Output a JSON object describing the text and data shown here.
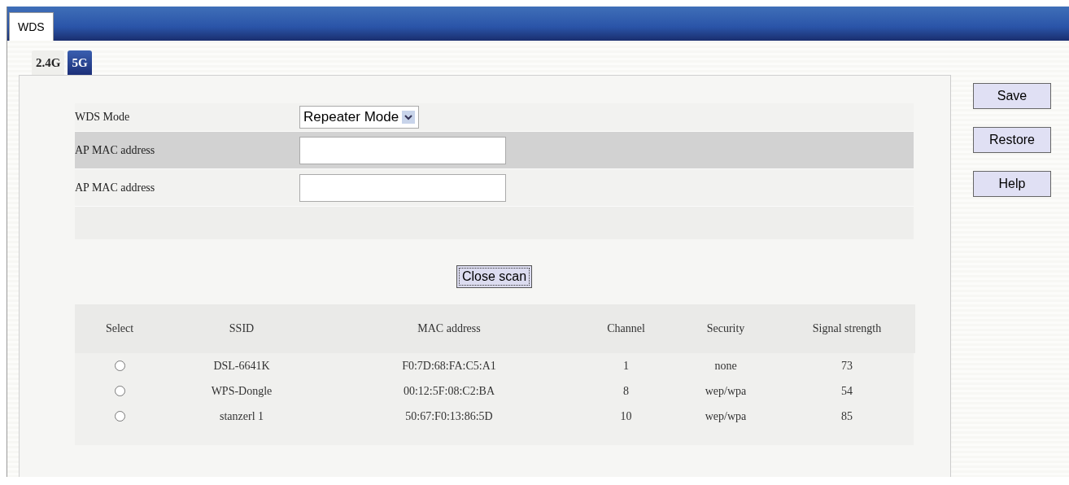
{
  "top_tab": {
    "label": "WDS",
    "selected": true
  },
  "band_tabs": [
    {
      "label": "2.4G",
      "selected": false
    },
    {
      "label": "5G",
      "selected": true
    }
  ],
  "form": {
    "rows": [
      {
        "kind": "select",
        "label": "WDS Mode",
        "value": "Repeater Mode",
        "shaded": false
      },
      {
        "kind": "input",
        "label": "AP MAC address",
        "shaded": true
      },
      {
        "kind": "input",
        "label": "AP MAC address",
        "shaded": false
      }
    ]
  },
  "scan_button": "Close scan",
  "table": {
    "columns": [
      "Select",
      "SSID",
      "MAC address",
      "Channel",
      "Security",
      "Signal strength"
    ],
    "rows": [
      {
        "selected": false,
        "cells": [
          "",
          "DSL-6641K",
          "F0:7D:68:FA:C5:A1",
          "1",
          "none",
          "73"
        ]
      },
      {
        "selected": false,
        "cells": [
          "",
          "WPS-Dongle",
          "00:12:5F:08:C2:BA",
          "8",
          "wep/wpa",
          "54"
        ]
      },
      {
        "selected": false,
        "cells": [
          "",
          "stanzerl 1",
          "50:67:F0:13:86:5D",
          "10",
          "wep/wpa",
          "85"
        ]
      }
    ]
  },
  "side_buttons": [
    "Save",
    "Restore",
    "Help"
  ]
}
